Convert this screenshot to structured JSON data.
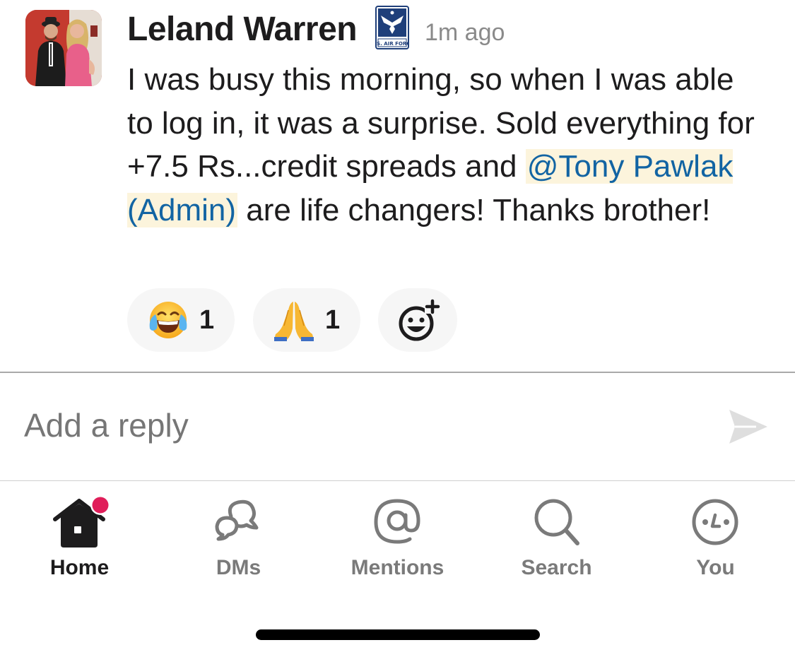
{
  "message": {
    "author": "Leland Warren",
    "badge_text": "U.S. AIR FORCE",
    "timestamp": "1m ago",
    "text_before": "I was busy this morning, so when I was able to log in, it was a surprise.  Sold everything for +7.5 Rs...credit spreads and ",
    "mention": "@Tony Pawlak (Admin)",
    "text_after": " are life changers!  Thanks brother!",
    "reactions": [
      {
        "emoji_name": "joy-emoji",
        "count": "1"
      },
      {
        "emoji_name": "pray-emoji",
        "count": "1"
      }
    ],
    "add_reaction_icon": "add-reaction-icon"
  },
  "reply": {
    "placeholder": "Add a reply",
    "send_icon": "send-icon"
  },
  "tabbar": {
    "tabs": [
      {
        "label": "Home",
        "icon": "home-icon",
        "active": true,
        "has_badge": true
      },
      {
        "label": "DMs",
        "icon": "dms-icon",
        "active": false
      },
      {
        "label": "Mentions",
        "icon": "at-icon",
        "active": false
      },
      {
        "label": "Search",
        "icon": "search-icon",
        "active": false
      },
      {
        "label": "You",
        "icon": "you-icon",
        "active": false
      }
    ]
  },
  "colors": {
    "mention_text": "#1264a3",
    "mention_bg": "#fcf4dc",
    "badge_dot": "#e01e5a",
    "inactive_tab": "#7a7a7a"
  }
}
